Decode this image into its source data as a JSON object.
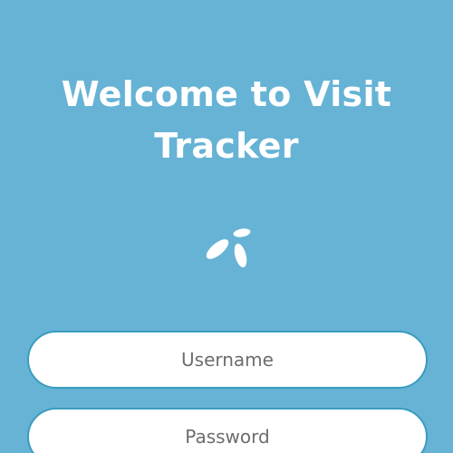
{
  "login": {
    "title_line1": "Welcome to Visit",
    "title_line2": "Tracker",
    "logo_icon": "telenor-propeller-icon",
    "username": {
      "placeholder": "Username",
      "value": ""
    },
    "password": {
      "placeholder": "Password",
      "value": ""
    }
  },
  "colors": {
    "background": "#66b3d6",
    "title_text": "#ffffff",
    "field_background": "#ffffff",
    "field_border": "#3a9cbf",
    "placeholder_text": "#6d6d6d"
  }
}
